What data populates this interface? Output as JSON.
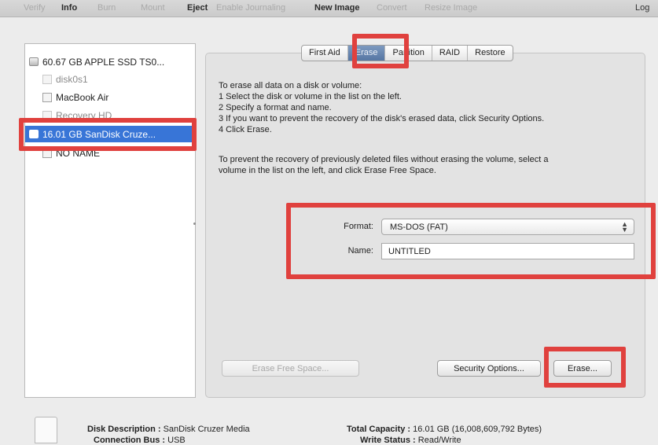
{
  "toolbar": {
    "items": [
      {
        "label": "Verify",
        "enabled": false
      },
      {
        "label": "Info",
        "enabled": true
      },
      {
        "label": "Burn",
        "enabled": false
      },
      {
        "label": "Mount",
        "enabled": false
      },
      {
        "label": "Eject",
        "enabled": true
      },
      {
        "label": "Enable Journaling",
        "enabled": false
      },
      {
        "label": "New Image",
        "enabled": true
      },
      {
        "label": "Convert",
        "enabled": false
      },
      {
        "label": "Resize Image",
        "enabled": false
      }
    ],
    "log_label": "Log"
  },
  "sidebar": {
    "items": [
      {
        "label": "60.67 GB APPLE SSD TS0...",
        "type": "drive",
        "selected": false
      },
      {
        "label": "disk0s1",
        "type": "volume",
        "selected": false
      },
      {
        "label": "MacBook Air",
        "type": "volume",
        "selected": false
      },
      {
        "label": "Recovery HD",
        "type": "volume",
        "selected": false
      },
      {
        "label": "16.01 GB SanDisk Cruze...",
        "type": "drive",
        "selected": true
      },
      {
        "label": "NO NAME",
        "type": "volume",
        "selected": false
      }
    ]
  },
  "tabs": [
    {
      "label": "First Aid",
      "active": false
    },
    {
      "label": "Erase",
      "active": true
    },
    {
      "label": "Partition",
      "active": false
    },
    {
      "label": "RAID",
      "active": false
    },
    {
      "label": "Restore",
      "active": false
    }
  ],
  "instructions": {
    "intro": "To erase all data on a disk or volume:",
    "step1": "1  Select the disk or volume in the list on the left.",
    "step2": "2  Specify a format and name.",
    "step3": "3  If you want to prevent the recovery of the disk's erased data, click Security Options.",
    "step4": "4  Click Erase.",
    "free_line1": "To prevent the recovery of previously deleted files without erasing the volume, select a",
    "free_line2": "volume in the list on the left, and click Erase Free Space."
  },
  "form": {
    "format_label": "Format:",
    "format_value": "MS-DOS (FAT)",
    "name_label": "Name:",
    "name_value": "UNTITLED"
  },
  "buttons": {
    "erase_free_space": "Erase Free Space...",
    "security_options": "Security Options...",
    "erase": "Erase..."
  },
  "info": {
    "disk_description_label": "Disk Description :",
    "disk_description_value": "SanDisk Cruzer Media",
    "connection_bus_label": "Connection Bus :",
    "connection_bus_value": "USB",
    "total_capacity_label": "Total Capacity :",
    "total_capacity_value": "16.01 GB (16,008,609,792 Bytes)",
    "write_status_label": "Write Status :",
    "write_status_value": "Read/Write"
  },
  "colors": {
    "highlight": "#e0413e",
    "selection": "#3875d7",
    "active_tab": "#6584ae"
  }
}
